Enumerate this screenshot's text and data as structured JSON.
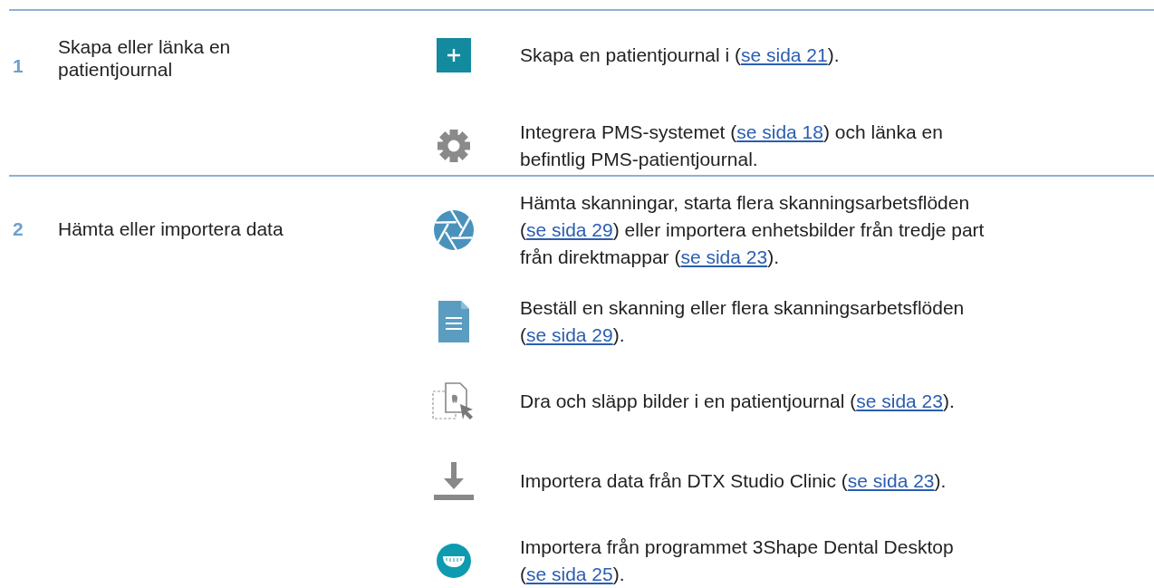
{
  "steps": [
    {
      "number": "1",
      "title": "Skapa eller länka en patientjournal",
      "actions": [
        {
          "kind": "plus",
          "lines": [
            [
              {
                "kind": "text",
                "text": "Skapa en patientjournal i ("
              },
              {
                "kind": "link",
                "text": "se sida 21"
              },
              {
                "kind": "text",
                "text": ")."
              }
            ]
          ]
        },
        {
          "kind": "gear",
          "lines": [
            [
              {
                "kind": "text",
                "text": "Integrera PMS-systemet ("
              },
              {
                "kind": "link",
                "text": "se sida 18"
              },
              {
                "kind": "text",
                "text": ") och länka en"
              }
            ],
            [
              {
                "kind": "text",
                "text": "befintlig PMS-patientjournal."
              }
            ]
          ]
        }
      ]
    },
    {
      "number": "2",
      "title": "Hämta eller importera data",
      "actions": [
        {
          "kind": "aperture",
          "lines": [
            [
              {
                "kind": "text",
                "text": "Hämta skanningar, starta flera skanningsarbetsflöden"
              }
            ],
            [
              {
                "kind": "text",
                "text": "("
              },
              {
                "kind": "link",
                "text": "se sida 29"
              },
              {
                "kind": "text",
                "text": ") eller importera enhetsbilder från tredje part"
              }
            ],
            [
              {
                "kind": "text",
                "text": "från direktmappar ("
              },
              {
                "kind": "link",
                "text": "se sida 23"
              },
              {
                "kind": "text",
                "text": ")."
              }
            ]
          ]
        },
        {
          "kind": "document",
          "lines": [
            [
              {
                "kind": "text",
                "text": "Beställ en skanning eller flera skanningsarbetsflöden"
              }
            ],
            [
              {
                "kind": "text",
                "text": "("
              },
              {
                "kind": "link",
                "text": "se sida 29"
              },
              {
                "kind": "text",
                "text": ")."
              }
            ]
          ]
        },
        {
          "kind": "dragdrop",
          "lines": [
            [
              {
                "kind": "text",
                "text": "Dra och släpp bilder i en patientjournal ("
              },
              {
                "kind": "link",
                "text": "se sida 23"
              },
              {
                "kind": "text",
                "text": ")."
              }
            ]
          ]
        },
        {
          "kind": "download",
          "lines": [
            [
              {
                "kind": "text",
                "text": "Importera data från DTX Studio Clinic ("
              },
              {
                "kind": "link",
                "text": "se sida 23"
              },
              {
                "kind": "text",
                "text": ")."
              }
            ]
          ]
        },
        {
          "kind": "dental",
          "lines": [
            [
              {
                "kind": "text",
                "text": "Importera från programmet 3Shape Dental Desktop"
              }
            ],
            [
              {
                "kind": "text",
                "text": "("
              },
              {
                "kind": "link",
                "text": "se sida 25"
              },
              {
                "kind": "text",
                "text": ")."
              }
            ]
          ]
        }
      ]
    }
  ]
}
